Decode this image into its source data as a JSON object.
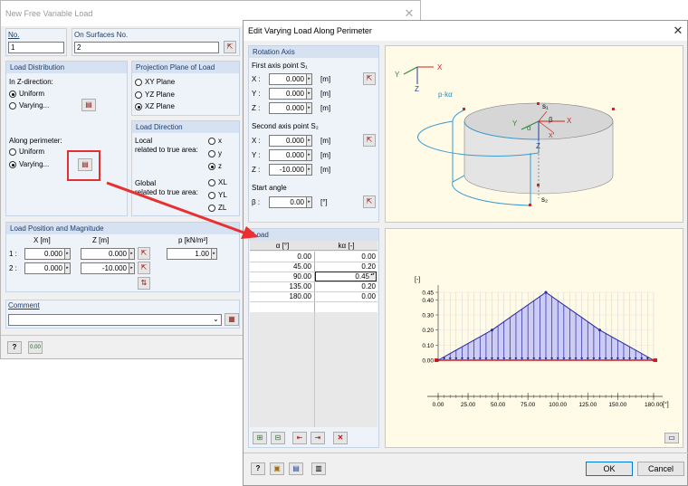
{
  "dlg1": {
    "title": "New Free Variable Load",
    "no_label": "No.",
    "no_value": "1",
    "surfaces_label": "On Surfaces No.",
    "surfaces_value": "2",
    "load_dist": {
      "header": "Load Distribution",
      "in_z": "In Z-direction:",
      "uniform": "Uniform",
      "varying": "Varying...",
      "along": "Along perimeter:",
      "uniform2": "Uniform",
      "varying2": "Varying..."
    },
    "proj": {
      "header": "Projection Plane of Load",
      "xy": "XY Plane",
      "yz": "YZ Plane",
      "xz": "XZ Plane"
    },
    "dir": {
      "header": "Load Direction",
      "local": "Local",
      "local_sub": "related to true area:",
      "x": "x",
      "y": "y",
      "z": "z",
      "global": "Global",
      "global_sub": "related to true area:",
      "xl": "XL",
      "yl": "YL",
      "zl": "ZL"
    },
    "pos": {
      "header": "Load Position and Magnitude",
      "x_col": "X [m]",
      "z_col": "Z [m]",
      "p_col": "p [kN/m²]",
      "r1": "1 :",
      "r2": "2 :",
      "x1": "0.000",
      "z1": "0.000",
      "x2": "0.000",
      "z2": "-10.000",
      "p1": "1.00"
    },
    "comment": {
      "header": "Comment",
      "value": ""
    }
  },
  "dlg2": {
    "title": "Edit Varying Load Along Perimeter",
    "rot": {
      "header": "Rotation Axis",
      "first": "First axis point S₁",
      "second": "Second axis point S₂",
      "start": "Start angle",
      "xl": "X :",
      "yl": "Y :",
      "zl": "Z :",
      "beta": "β :",
      "m": "[m]",
      "deg": "[°]",
      "s1x": "0.000",
      "s1y": "0.000",
      "s1z": "0.000",
      "s2x": "0.000",
      "s2y": "0.000",
      "s2z": "-10.000",
      "bval": "0.00"
    },
    "load": {
      "header": "Load",
      "col_a": "α [°]",
      "col_k": "kα [-]",
      "rows": [
        {
          "a": "0.00",
          "k": "0.00"
        },
        {
          "a": "45.00",
          "k": "0.20"
        },
        {
          "a": "90.00",
          "k": "0.45"
        },
        {
          "a": "135.00",
          "k": "0.20"
        },
        {
          "a": "180.00",
          "k": "0.00"
        }
      ]
    },
    "diagram": {
      "pk": "p·kα",
      "s1": "s₁",
      "s2": "s₂",
      "x": "X",
      "y": "Y",
      "z": "Z",
      "alpha": "α",
      "beta": "β",
      "xprime": "X'"
    },
    "ok": "OK",
    "cancel": "Cancel"
  },
  "chart_data": {
    "type": "area",
    "ylabel": "[-]",
    "xlabel": "[°]",
    "x": [
      0,
      45,
      90,
      135,
      180
    ],
    "values": [
      0,
      0.2,
      0.45,
      0.2,
      0
    ],
    "xticks": [
      "0.00",
      "25.00",
      "50.00",
      "75.00",
      "100.00",
      "125.00",
      "150.00",
      "180.00"
    ],
    "xtickvals": [
      0,
      25,
      50,
      75,
      100,
      125,
      150,
      180
    ],
    "yticks": [
      "0.45",
      "0.40",
      "0.30",
      "0.20",
      "0.10",
      "0.00"
    ],
    "ytickvals": [
      0.45,
      0.4,
      0.3,
      0.2,
      0.1,
      0
    ],
    "xlim": [
      0,
      180
    ],
    "ylim": [
      0,
      0.45
    ],
    "fill": "#ccccf4",
    "line": "#2828a0"
  }
}
